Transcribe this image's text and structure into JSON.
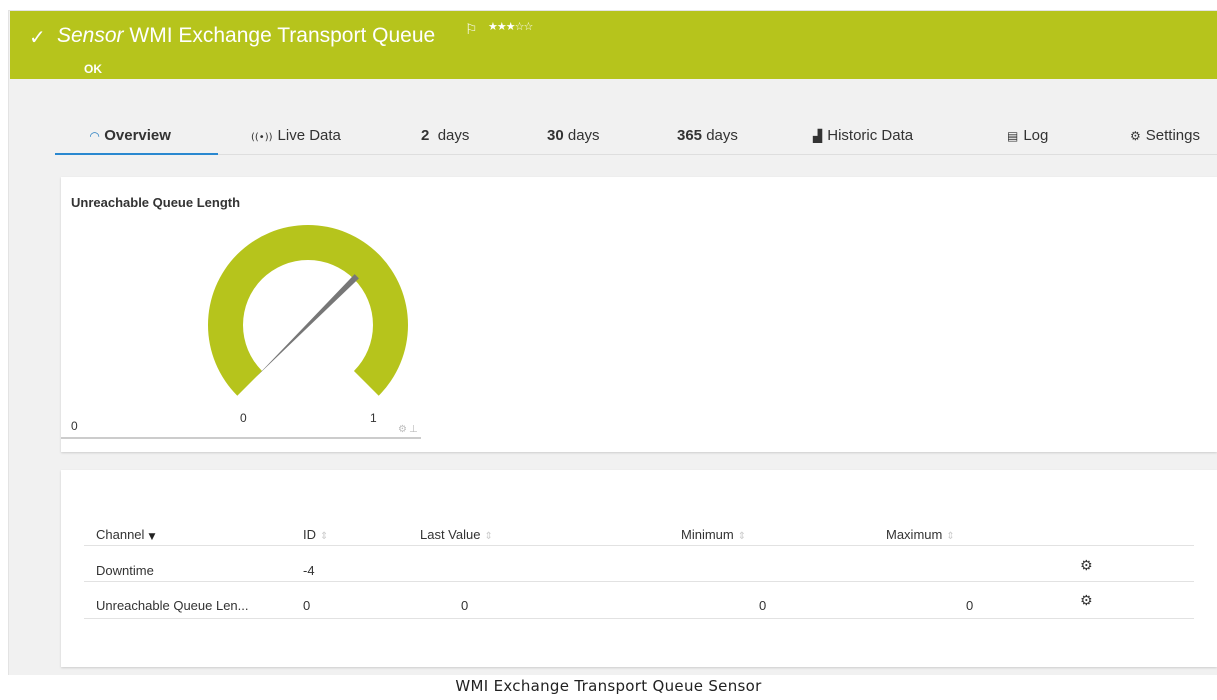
{
  "header": {
    "sensor_kind": "Sensor",
    "sensor_name": "WMI Exchange Transport Queue",
    "status": "OK",
    "flag_icon": "⚐",
    "priority_stars": "★★★☆☆",
    "color": "#b6c41c"
  },
  "tabs": [
    {
      "label": "Overview",
      "icon": "gauge-icon"
    },
    {
      "label": "Live Data",
      "icon": "live-data-icon"
    },
    {
      "num": "2",
      "unit": "days"
    },
    {
      "num": "30",
      "unit": "days"
    },
    {
      "num": "365",
      "unit": "days"
    },
    {
      "label": "Historic Data",
      "icon": "area-chart-icon"
    },
    {
      "label": "Log",
      "icon": "log-icon"
    },
    {
      "label": "Settings",
      "icon": "gear-icon"
    }
  ],
  "gauge": {
    "title": "Unreachable Queue Length",
    "value": 0,
    "min_label": "0",
    "max_label": "1",
    "left_value": "0",
    "color": "#b6c41c"
  },
  "table": {
    "columns": [
      "Channel",
      "ID",
      "Last Value",
      "Minimum",
      "Maximum"
    ],
    "rows": [
      {
        "channel": "Downtime",
        "id": "-4",
        "last_value": "",
        "minimum": "",
        "maximum": ""
      },
      {
        "channel": "Unreachable Queue Len...",
        "id": "0",
        "last_value": "0",
        "minimum": "0",
        "maximum": "0"
      }
    ]
  },
  "caption": "WMI Exchange Transport Queue Sensor"
}
